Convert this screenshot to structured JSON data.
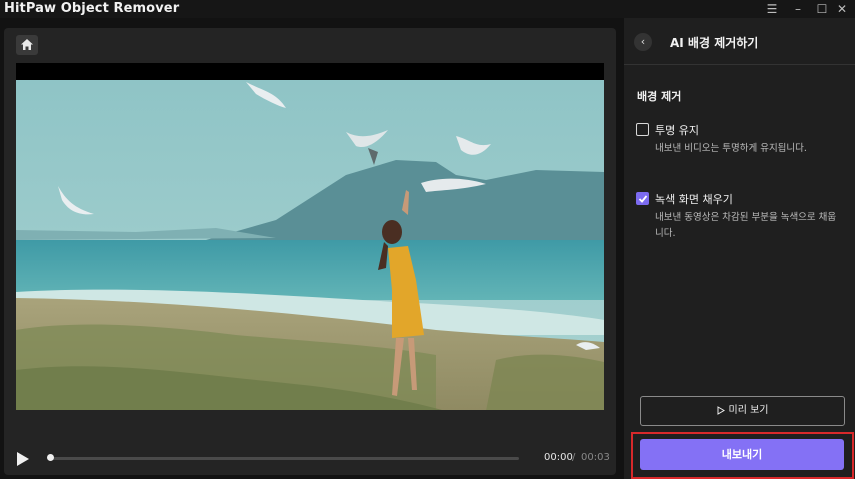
{
  "app": {
    "title": "HitPaw Object Remover",
    "window_controls": [
      "☰",
      "–",
      "☐",
      "✕"
    ]
  },
  "player": {
    "current_time": "00:00",
    "separator": "/",
    "total_time": "00:03",
    "progress": 0
  },
  "panel": {
    "back_icon": "‹",
    "title": "AI 배경 제거하기",
    "section_title": "배경 제거",
    "options": [
      {
        "label": "투명 유지",
        "description": "내보낸 비디오는 투명하게 유지됩니다.",
        "checked": false
      },
      {
        "label": "녹색 화면 채우기",
        "description": "내보낸 동영상은 차감된 부분을 녹색으로 채웁니다.",
        "checked": true
      }
    ],
    "preview_label": "미리 보기",
    "export_label": "내보내기"
  },
  "colors": {
    "accent": "#8471f5",
    "highlight": "#d8292b",
    "background": "#121212"
  }
}
